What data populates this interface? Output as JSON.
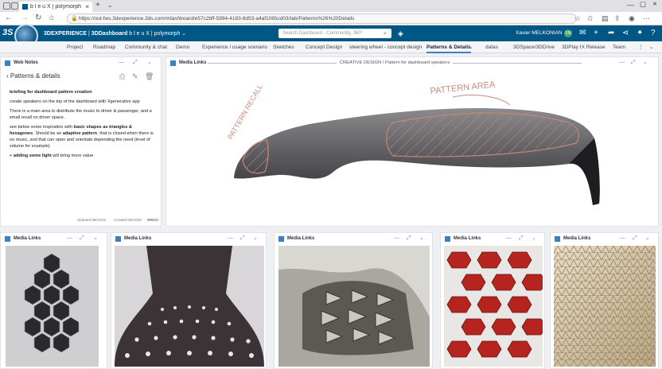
{
  "browser": {
    "tab_title": "b l e u X | polymorph",
    "url": "https://out-fws.3dexperience.3ds.com/#dashboard/e57c2bff-5994-4183-8d53-a4af1065cd03/tab/Patterns%26%20Details",
    "new_tab": "+",
    "tab_close": "×"
  },
  "app_header": {
    "brand_3dx": "3DEXPERIENCE",
    "brand_app": "3DDashboard",
    "brand_board": "b l e u X | polymorph",
    "search_placeholder": "Search Dashboard - Community, 360°",
    "user_name": "Xavier MELKONIAN",
    "avatar_initials": "XM"
  },
  "tabs": [
    {
      "label": "Project"
    },
    {
      "label": "Roadmap"
    },
    {
      "label": "Community & chat"
    },
    {
      "label": "Demo"
    },
    {
      "label": "Experience / usage scenario"
    },
    {
      "label": "Sketches"
    },
    {
      "label": "Concept Design"
    },
    {
      "label": "steering wheel - concept design"
    },
    {
      "label": "Patterns & Details"
    },
    {
      "label": "datas"
    },
    {
      "label": "3DSpace/3DDrive"
    },
    {
      "label": "3DPlay IX Release"
    },
    {
      "label": "Team"
    }
  ],
  "web_notes": {
    "title": "Web Notes",
    "crumb": "Patterns & details",
    "heading": "briefing for dashboard pattern creation",
    "p1": "create speakers on the top of the dashboard with Xgenerative app",
    "p2": "There is a main area to distribute the music to driver & passenger, and a small recall on driver space.",
    "p3_a": "see below some inspiration with ",
    "p3_b": "basic shapes as triangles & hexagones",
    "p3_c": ". Should be an ",
    "p3_d": "adaptive pattern",
    "p3_e": ", that is closed when there is no music, and that can open and orientate depending the need (level of volume for example)",
    "p4_a": "+ ",
    "p4_b": "adding some light",
    "p4_c": " will bring more value",
    "footer_updated": "Updated 06/10/19",
    "footer_created": "Created 06/10/19",
    "footer_count": "999/10"
  },
  "main_media": {
    "title": "Media Links",
    "caption": "CREATIVE DESIGN / Pattern for dashboard speakers",
    "annotation_area": "PATTERN AREA",
    "annotation_recall": "PATTERN RECALL"
  },
  "media_cards": [
    {
      "title": "Media Links"
    },
    {
      "title": "Media Links"
    },
    {
      "title": "Media Links"
    },
    {
      "title": "Media Links"
    },
    {
      "title": "Media Links"
    }
  ],
  "colors": {
    "header_bg": "#005685",
    "accent": "#3d7fc1",
    "sketch_annotation": "#c98a7a"
  }
}
